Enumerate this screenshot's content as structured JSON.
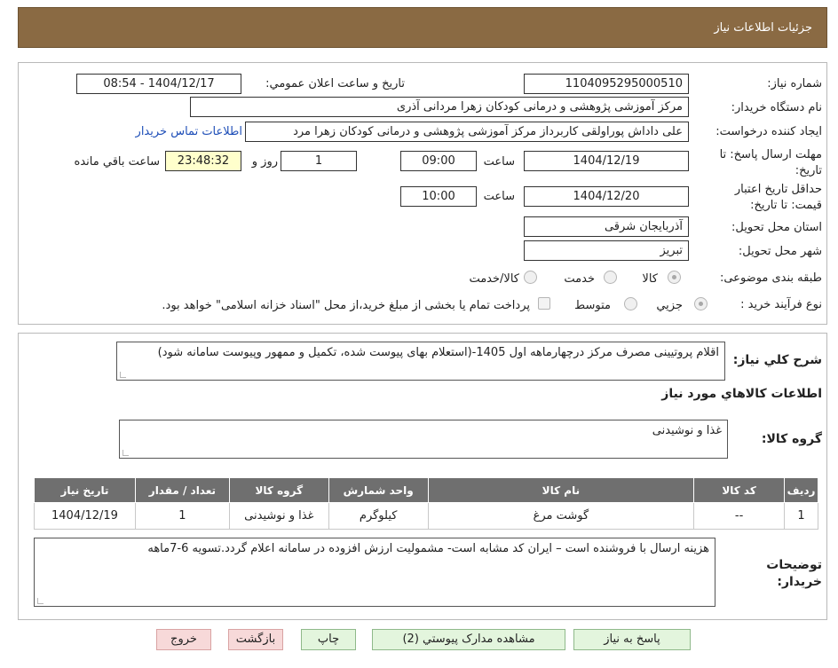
{
  "header": {
    "title": "جزئیات اطلاعات نیاز"
  },
  "form": {
    "need_number_label": "شماره نیاز:",
    "need_number": "1104095295000510",
    "announce_label": "تاریخ و ساعت اعلان عمومي:",
    "announce_value": "1404/12/17 - 08:54",
    "buyer_org_label": "نام دستگاه خريدار:",
    "buyer_org": "مرکز آموزشی پژوهشی و درمانی کودکان زهرا مردانی آذری",
    "creator_label": "ايجاد کننده درخواست:",
    "creator": "علی داداش پوراولقی کاربرداز مرکز آموزشی پژوهشی و درمانی کودکان زهرا مرد",
    "contact_link": "اطلاعات تماس خريدار",
    "deadline_label": "مهلت ارسال پاسخ: تا تاريخ:",
    "deadline_date": "1404/12/19",
    "time_label": "ساعت",
    "deadline_time": "09:00",
    "days_value": "1",
    "days_label": "روز و",
    "remaining_time": "23:48:32",
    "remaining_label": "ساعت باقي مانده",
    "validity_label": "حداقل تاريخ اعتبار قيمت: تا تاريخ:",
    "validity_date": "1404/12/20",
    "validity_time": "10:00",
    "province_label": "استان محل تحويل:",
    "province": "آذربايجان شرقی",
    "city_label": "شهر محل تحويل:",
    "city": "تبريز",
    "category_label": "طبقه بندی موضوعی:",
    "category_options": [
      "کالا",
      "خدمت",
      "کالا/خدمت"
    ],
    "category_selected": "کالا",
    "process_label": "نوع فرآيند خريد :",
    "process_options": [
      "جزيي",
      "متوسط"
    ],
    "process_selected": "جزيي",
    "payment_note": "پرداخت تمام يا بخشی از مبلغ خريد،از محل \"اسناد خزانه اسلامی\" خواهد بود."
  },
  "summary": {
    "label": "شرح کلي نياز:",
    "text": "اقلام پروتیینی مصرف مرکز درچهارماهه اول 1405-(استعلام بهای پیوست شده، تکمیل و ممهور وپیوست سامانه شود)"
  },
  "goods": {
    "section_title": "اطلاعات کالاهاي مورد نياز",
    "group_label": "گروه کالا:",
    "group_value": "غذا و نوشیدنی",
    "table": {
      "headers": [
        "رديف",
        "کد کالا",
        "نام کالا",
        "واحد شمارش",
        "گروه کالا",
        "تعداد / مقدار",
        "تاريخ نياز"
      ],
      "rows": [
        [
          "1",
          "--",
          "گوشت مرغ",
          "کیلوگرم",
          "غذا و نوشیدنی",
          "1",
          "1404/12/19"
        ]
      ]
    }
  },
  "buyer_notes": {
    "label": "توضيحات خريدار:",
    "text": "هزینه ارسال با فروشنده است – ایران کد مشابه است- مشمولیت ارزش افزوده در سامانه  اعلام  گردد.تسویه 6-7ماهه"
  },
  "buttons": {
    "reply": "پاسخ به نياز",
    "attachments": "مشاهده مدارک پيوستي (2)",
    "print": "چاپ",
    "back": "بازگشت",
    "exit": "خروج"
  },
  "watermark": {
    "text": "AriaTender.neT"
  },
  "colors": {
    "header_bg": "#8a6a43",
    "table_header_bg": "#6f6f6f",
    "button_green": "#e3f5dd",
    "button_red": "#f7d9d9",
    "link": "#1f4fb8"
  }
}
